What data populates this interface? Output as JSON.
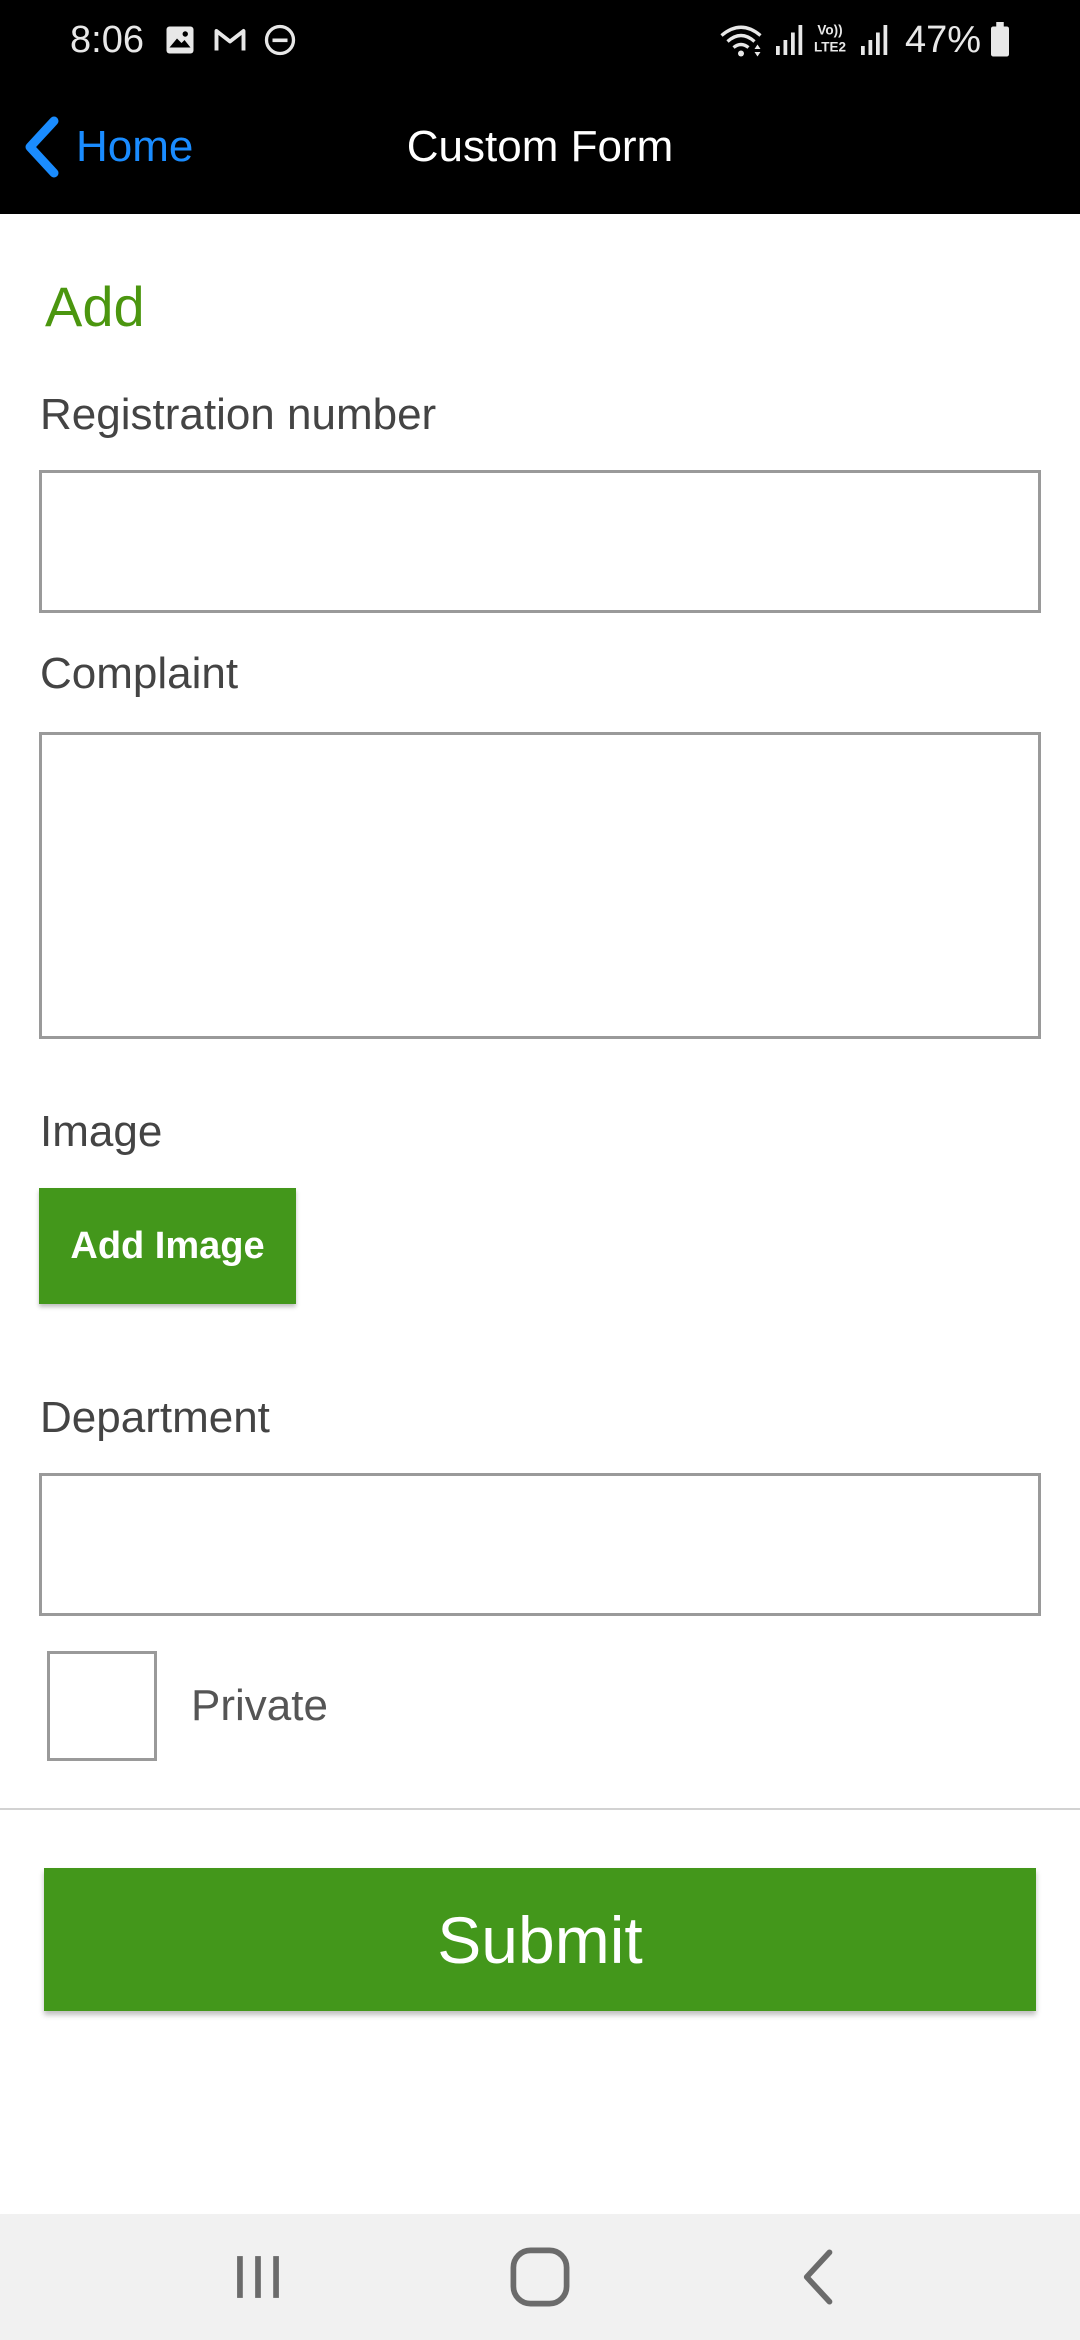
{
  "status_bar": {
    "time": "8:06",
    "battery_percent": "47%",
    "notification_icons": [
      "image-icon",
      "gmail-icon",
      "do-not-disturb-icon"
    ],
    "system_icons": [
      "wifi-icon",
      "signal-icon",
      "volte-lte2-icon",
      "signal-icon",
      "battery-icon"
    ]
  },
  "nav": {
    "back_label": "Home",
    "title": "Custom Form",
    "back_icon": "chevron-left-icon"
  },
  "form": {
    "heading": "Add",
    "registration_label": "Registration number",
    "registration_value": "",
    "complaint_label": "Complaint",
    "complaint_value": "",
    "image_label": "Image",
    "add_image_label": "Add Image",
    "department_label": "Department",
    "department_value": "",
    "private_label": "Private",
    "private_checked": false,
    "submit_label": "Submit"
  },
  "system_nav": {
    "buttons": [
      "recent-apps-icon",
      "home-icon",
      "back-icon"
    ]
  },
  "colors": {
    "accent_green": "#43971b",
    "link_blue": "#1a8cff",
    "header_bg": "#000000"
  }
}
